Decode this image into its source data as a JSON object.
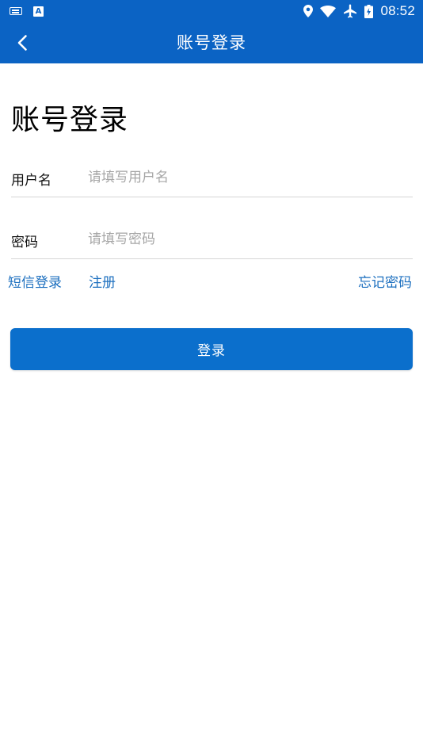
{
  "status_bar": {
    "time": "08:52",
    "icons": [
      "keyboard-icon",
      "a-icon",
      "location-icon",
      "wifi-icon",
      "airplane-icon",
      "battery-icon"
    ],
    "a_label": "A"
  },
  "app_bar": {
    "title": "账号登录",
    "back_icon": "chevron-left-icon"
  },
  "page": {
    "heading": "账号登录"
  },
  "form": {
    "username_label": "用户名",
    "username_placeholder": "请填写用户名",
    "username_value": "",
    "password_label": "密码",
    "password_placeholder": "请填写密码",
    "password_value": ""
  },
  "links": {
    "sms_login": "短信登录",
    "register": "注册",
    "forgot_password": "忘记密码"
  },
  "submit": {
    "label": "登录"
  },
  "colors": {
    "primary": "#0b63c4",
    "button": "#0b6fcc",
    "link": "#1c6fbf",
    "placeholder": "#a6a6a6",
    "divider": "#d6d6d6"
  }
}
